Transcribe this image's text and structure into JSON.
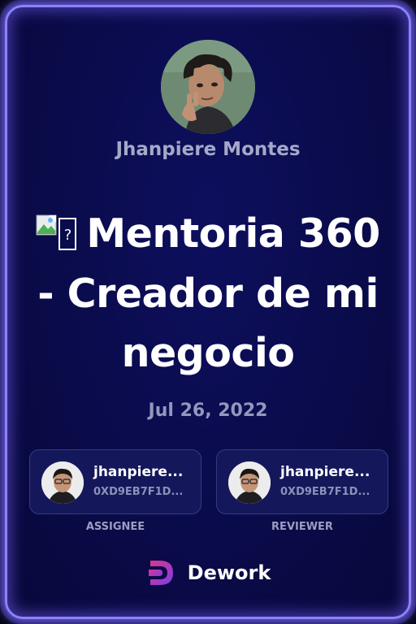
{
  "owner": {
    "name": "Jhanpiere Montes"
  },
  "task": {
    "title": "Mentoria 360 - Creador de mi negocio",
    "date": "Jul 26, 2022"
  },
  "assignee": {
    "name": "jhanpiere...",
    "address": "0XD9EB7F1D...",
    "role": "ASSIGNEE"
  },
  "reviewer": {
    "name": "jhanpiere...",
    "address": "0XD9EB7F1D...",
    "role": "REVIEWER"
  },
  "brand": {
    "name": "Dework"
  },
  "icons": {
    "title_prefix": "broken-image-icon",
    "brand_logo": "dework-logo-icon"
  },
  "colors": {
    "border_glow": "#8c82ff",
    "background": "#0a0b4a",
    "accent_pink": "#e0338f",
    "accent_purple": "#7b3fe4"
  }
}
